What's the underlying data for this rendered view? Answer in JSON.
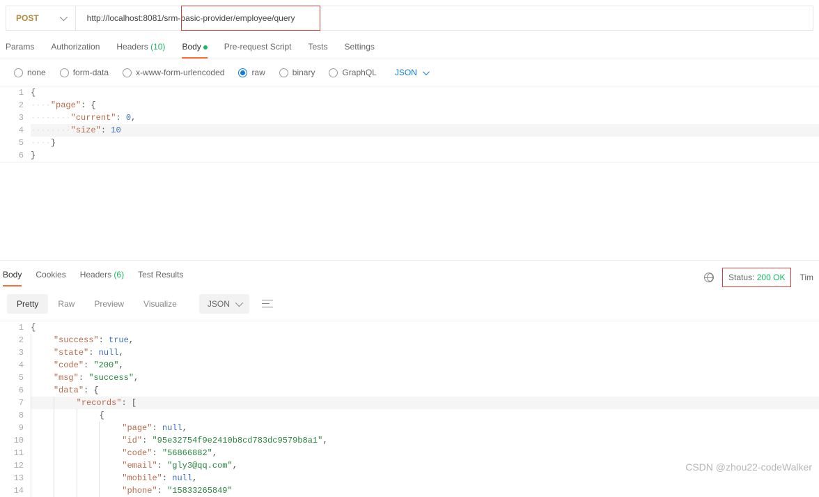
{
  "request": {
    "method": "POST",
    "url": "http://localhost:8081/srm-basic-provider/employee/query"
  },
  "tabs": {
    "items": [
      "Params",
      "Authorization",
      "Headers",
      "Body",
      "Pre-request Script",
      "Tests",
      "Settings"
    ],
    "headers_count": "(10)",
    "active_index": 3
  },
  "body_types": {
    "options": [
      "none",
      "form-data",
      "x-www-form-urlencoded",
      "raw",
      "binary",
      "GraphQL"
    ],
    "selected_index": 3,
    "format": "JSON"
  },
  "request_body": {
    "lines": [
      {
        "n": "1",
        "t": [
          [
            "p",
            "{"
          ]
        ]
      },
      {
        "n": "2",
        "t": [
          [
            "guide",
            "····"
          ],
          [
            "k",
            "\"page\""
          ],
          [
            "p",
            ": {"
          ]
        ]
      },
      {
        "n": "3",
        "t": [
          [
            "guide",
            "····"
          ],
          [
            "guide",
            "····"
          ],
          [
            "k",
            "\"current\""
          ],
          [
            "p",
            ": "
          ],
          [
            "n",
            "0"
          ],
          [
            "p",
            ","
          ]
        ]
      },
      {
        "n": "4",
        "t": [
          [
            "guide",
            "····"
          ],
          [
            "guide",
            "····"
          ],
          [
            "k",
            "\"size\""
          ],
          [
            "p",
            ": "
          ],
          [
            "n",
            "10"
          ]
        ],
        "hl": true
      },
      {
        "n": "5",
        "t": [
          [
            "guide",
            "····"
          ],
          [
            "p",
            "}"
          ]
        ]
      },
      {
        "n": "6",
        "t": [
          [
            "p",
            "}"
          ]
        ]
      }
    ]
  },
  "response": {
    "tabs": [
      "Body",
      "Cookies",
      "Headers",
      "Test Results"
    ],
    "headers_count": "(6)",
    "active_index": 0,
    "status_label": "Status:",
    "status_value": "200 OK",
    "time_label": "Tim",
    "view_modes": [
      "Pretty",
      "Raw",
      "Preview",
      "Visualize"
    ],
    "view_active": 0,
    "format": "JSON",
    "lines": [
      {
        "n": "1",
        "t": [
          [
            "p",
            "{"
          ]
        ]
      },
      {
        "n": "2",
        "indent": 1,
        "t": [
          [
            "k",
            "\"success\""
          ],
          [
            "p",
            ": "
          ],
          [
            "b",
            "true"
          ],
          [
            "p",
            ","
          ]
        ]
      },
      {
        "n": "3",
        "indent": 1,
        "t": [
          [
            "k",
            "\"state\""
          ],
          [
            "p",
            ": "
          ],
          [
            "b",
            "null"
          ],
          [
            "p",
            ","
          ]
        ]
      },
      {
        "n": "4",
        "indent": 1,
        "t": [
          [
            "k",
            "\"code\""
          ],
          [
            "p",
            ": "
          ],
          [
            "s",
            "\"200\""
          ],
          [
            "p",
            ","
          ]
        ]
      },
      {
        "n": "5",
        "indent": 1,
        "t": [
          [
            "k",
            "\"msg\""
          ],
          [
            "p",
            ": "
          ],
          [
            "s",
            "\"success\""
          ],
          [
            "p",
            ","
          ]
        ]
      },
      {
        "n": "6",
        "indent": 1,
        "t": [
          [
            "k",
            "\"data\""
          ],
          [
            "p",
            ": {"
          ]
        ]
      },
      {
        "n": "7",
        "indent": 2,
        "t": [
          [
            "k",
            "\"records\""
          ],
          [
            "p",
            ": ["
          ]
        ],
        "hl": true
      },
      {
        "n": "8",
        "indent": 3,
        "t": [
          [
            "p",
            "{"
          ]
        ]
      },
      {
        "n": "9",
        "indent": 4,
        "t": [
          [
            "k",
            "\"page\""
          ],
          [
            "p",
            ": "
          ],
          [
            "b",
            "null"
          ],
          [
            "p",
            ","
          ]
        ]
      },
      {
        "n": "10",
        "indent": 4,
        "t": [
          [
            "k",
            "\"id\""
          ],
          [
            "p",
            ": "
          ],
          [
            "s",
            "\"95e32754f9e2410b8cd783dc9579b8a1\""
          ],
          [
            "p",
            ","
          ]
        ]
      },
      {
        "n": "11",
        "indent": 4,
        "t": [
          [
            "k",
            "\"code\""
          ],
          [
            "p",
            ": "
          ],
          [
            "s",
            "\"56866882\""
          ],
          [
            "p",
            ","
          ]
        ]
      },
      {
        "n": "12",
        "indent": 4,
        "t": [
          [
            "k",
            "\"email\""
          ],
          [
            "p",
            ": "
          ],
          [
            "s",
            "\"gly3@qq.com\""
          ],
          [
            "p",
            ","
          ]
        ]
      },
      {
        "n": "13",
        "indent": 4,
        "t": [
          [
            "k",
            "\"mobile\""
          ],
          [
            "p",
            ": "
          ],
          [
            "b",
            "null"
          ],
          [
            "p",
            ","
          ]
        ]
      },
      {
        "n": "14",
        "indent": 4,
        "t": [
          [
            "k",
            "\"phone\""
          ],
          [
            "p",
            ": "
          ],
          [
            "s",
            "\"15833265849\""
          ]
        ]
      }
    ]
  },
  "watermark": "CSDN @zhou22-codeWalker"
}
